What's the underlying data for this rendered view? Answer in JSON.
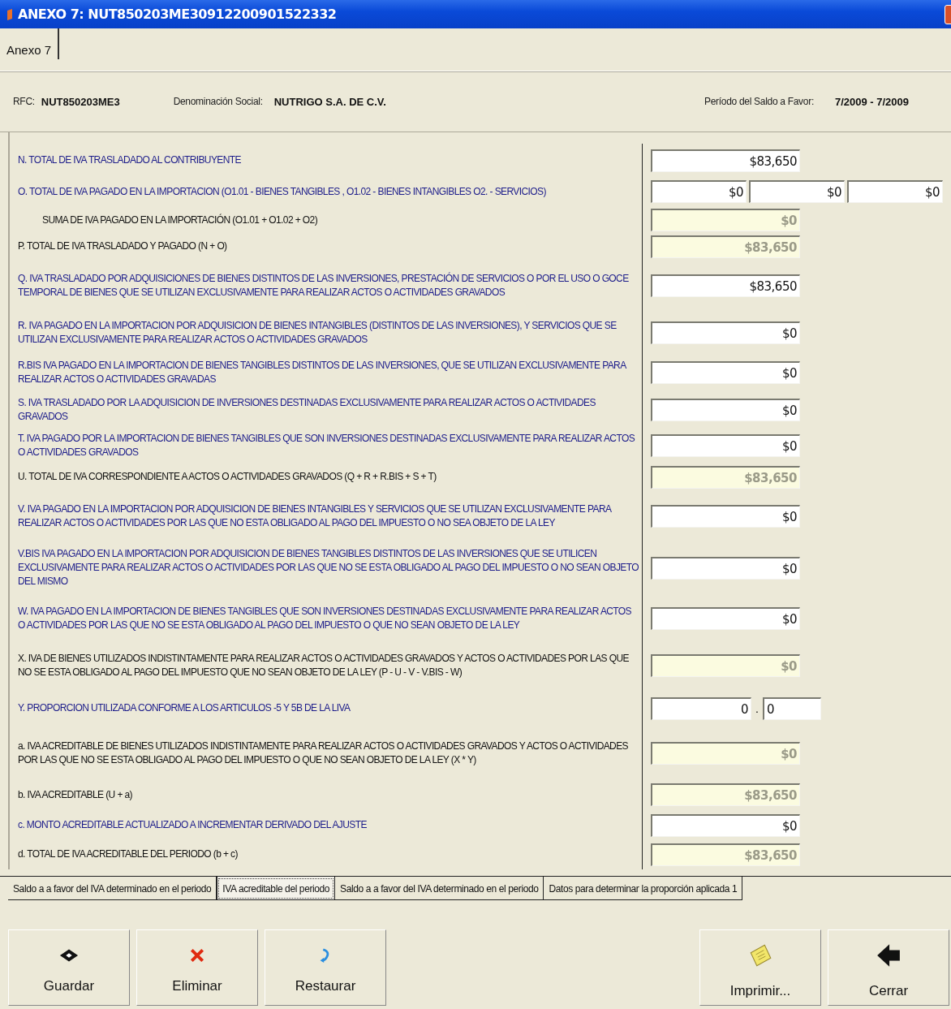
{
  "window": {
    "title": "ANEXO 7: NUT850203ME30912200901522332"
  },
  "top_tabs": [
    {
      "label": "Anexo 7"
    }
  ],
  "header": {
    "rfc_label": "RFC:",
    "rfc": "NUT850203ME3",
    "denominacion_label": "Denominación Social:",
    "denominacion": "NUTRIGO S.A. DE C.V.",
    "periodo_label": "Período del Saldo a Favor:",
    "periodo": "7/2009 - 7/2009"
  },
  "rows": [
    {
      "kind": "input",
      "label": "N. TOTAL DE IVA TRASLADADO AL CONTRIBUYENTE",
      "fields": [
        {
          "value": "$83,650",
          "disabled": false
        }
      ]
    },
    {
      "kind": "input",
      "label": "O.  TOTAL DE IVA PAGADO EN LA IMPORTACION (O1.01 - BIENES TANGIBLES , O1.02 - BIENES INTANGIBLES  O2. - SERVICIOS)",
      "fields": [
        {
          "value": "$0",
          "disabled": false
        },
        {
          "value": "$0",
          "disabled": false
        },
        {
          "value": "$0",
          "disabled": false
        }
      ]
    },
    {
      "kind": "sub",
      "label": "SUMA DE IVA PAGADO EN LA IMPORTACIÓN (O1.01 + O1.02 + O2)",
      "fields": [
        {
          "value": "$0",
          "disabled": true
        }
      ]
    },
    {
      "kind": "calculated",
      "label": "P. TOTAL DE IVA TRASLADADO Y PAGADO (N + O)",
      "fields": [
        {
          "value": "$83,650",
          "disabled": true
        }
      ]
    },
    {
      "kind": "input",
      "label": "Q. IVA TRASLADADO POR ADQUISICIONES DE BIENES DISTINTOS DE LAS INVERSIONES, PRESTACIÓN DE SERVICIOS O POR EL USO O GOCE TEMPORAL DE BIENES QUE SE UTILIZAN EXCLUSIVAMENTE PARA REALIZAR ACTOS O ACTIVIDADES GRAVADOS",
      "fields": [
        {
          "value": "$83,650",
          "disabled": false
        }
      ]
    },
    {
      "kind": "input",
      "label": "R. IVA PAGADO EN LA IMPORTACION POR ADQUISICION DE BIENES INTANGIBLES (DISTINTOS DE LAS INVERSIONES), Y SERVICIOS QUE SE UTILIZAN EXCLUSIVAMENTE PARA REALIZAR ACTOS O ACTIVIDADES GRAVADOS",
      "fields": [
        {
          "value": "$0",
          "disabled": false
        }
      ]
    },
    {
      "kind": "input",
      "label": "R.BIS  IVA PAGADO EN LA IMPORTACION DE BIENES TANGIBLES DISTINTOS DE LAS INVERSIONES, QUE SE UTILIZAN EXCLUSIVAMENTE PARA REALIZAR ACTOS O ACTIVIDADES GRAVADAS",
      "fields": [
        {
          "value": "$0",
          "disabled": false
        }
      ]
    },
    {
      "kind": "input",
      "label": "S. IVA TRASLADADO POR LA ADQUISICION DE INVERSIONES DESTINADAS EXCLUSIVAMENTE PARA REALIZAR ACTOS O ACTIVIDADES GRAVADOS",
      "fields": [
        {
          "value": "$0",
          "disabled": false
        }
      ]
    },
    {
      "kind": "input",
      "label": "T. IVA PAGADO POR LA IMPORTACION DE BIENES TANGIBLES QUE SON INVERSIONES DESTINADAS EXCLUSIVAMENTE PARA REALIZAR ACTOS O ACTIVIDADES GRAVADOS",
      "fields": [
        {
          "value": "$0",
          "disabled": false
        }
      ]
    },
    {
      "kind": "calculated",
      "label": "U. TOTAL DE IVA CORRESPONDIENTE A ACTOS O ACTIVIDADES GRAVADOS  (Q + R + R.BIS + S + T)",
      "fields": [
        {
          "value": "$83,650",
          "disabled": true
        }
      ]
    },
    {
      "kind": "input",
      "label": "V. IVA PAGADO EN LA IMPORTACION POR ADQUISICION DE BIENES INTANGIBLES Y SERVICIOS QUE SE UTILIZAN EXCLUSIVAMENTE PARA REALIZAR ACTOS O ACTIVIDADES POR LAS QUE NO ESTA OBLIGADO AL PAGO DEL IMPUESTO O NO SEA OBJETO DE LA LEY",
      "fields": [
        {
          "value": "$0",
          "disabled": false
        }
      ]
    },
    {
      "kind": "input",
      "label": "V.BIS  IVA PAGADO EN LA IMPORTACION POR ADQUISICION DE BIENES TANGIBLES DISTINTOS DE LAS INVERSIONES QUE SE UTILICEN EXCLUSIVAMENTE PARA REALIZAR ACTOS O ACTIVIDADES POR LAS QUE NO SE ESTA OBLIGADO AL PAGO DEL IMPUESTO O NO SEAN OBJETO DEL MISMO",
      "fields": [
        {
          "value": "$0",
          "disabled": false
        }
      ]
    },
    {
      "kind": "input",
      "label": "W. IVA PAGADO EN LA IMPORTACION DE BIENES TANGIBLES QUE SON INVERSIONES DESTINADAS EXCLUSIVAMENTE PARA REALIZAR ACTOS O ACTIVIDADES POR LAS QUE NO SE ESTA OBLIGADO AL PAGO DEL IMPUESTO O QUE NO SEAN OBJETO DE LA LEY",
      "fields": [
        {
          "value": "$0",
          "disabled": false
        }
      ]
    },
    {
      "kind": "calculated",
      "label": "X. IVA DE BIENES UTILIZADOS INDISTINTAMENTE PARA REALIZAR ACTOS O ACTIVIDADES GRAVADOS Y ACTOS O ACTIVIDADES POR LAS QUE NO SE ESTA OBLIGADO AL PAGO DEL IMPUESTO QUE NO SEAN OBJETO DE LA LEY (P - U - V - V.BIS - W)",
      "fields": [
        {
          "value": "$0",
          "disabled": true
        }
      ]
    },
    {
      "kind": "ratio",
      "label": "Y. PROPORCION UTILIZADA CONFORME A LOS ARTICULOS -5 Y 5B DE LA LIVA",
      "separator": ".",
      "fields": [
        {
          "value": "0",
          "disabled": false
        },
        {
          "value": "0",
          "disabled": false
        }
      ]
    },
    {
      "kind": "calculated",
      "label": "a. IVA ACREDITABLE DE BIENES UTILIZADOS INDISTINTAMENTE PARA REALIZAR ACTOS O ACTIVIDADES GRAVADOS Y ACTOS O ACTIVIDADES POR LAS QUE NO SE ESTA OBLIGADO AL PAGO DEL IMPUESTO O QUE NO SEAN OBJETO DE LA LEY (X * Y)",
      "fields": [
        {
          "value": "$0",
          "disabled": true
        }
      ]
    },
    {
      "kind": "calculated",
      "label": "b. IVA ACREDITABLE (U + a)",
      "fields": [
        {
          "value": "$83,650",
          "disabled": true
        }
      ]
    },
    {
      "kind": "input",
      "label": "c. MONTO ACREDITABLE ACTUALIZADO A INCREMENTAR DERIVADO DEL AJUSTE",
      "fields": [
        {
          "value": "$0",
          "disabled": false
        }
      ]
    },
    {
      "kind": "calculated",
      "label": "d. TOTAL DE IVA ACREDITABLE DEL PERIODO (b + c)",
      "fields": [
        {
          "value": "$83,650",
          "disabled": true
        }
      ]
    }
  ],
  "bottom_tabs": [
    {
      "label": "Saldo a a favor del IVA determinado en el periodo",
      "selected": false
    },
    {
      "label": "IVA acreditable del periodo",
      "selected": true
    },
    {
      "label": "Saldo a a favor del IVA determinado en el periodo",
      "selected": false
    },
    {
      "label": "Datos para determinar la proporción aplicada 1",
      "selected": false
    }
  ],
  "buttons": [
    {
      "label": "Guardar",
      "kind": "save"
    },
    {
      "label": "Eliminar",
      "kind": "delete"
    },
    {
      "label": "Restaurar",
      "kind": "restore"
    },
    {
      "label": "Imprimir...",
      "kind": "print"
    },
    {
      "label": "Cerrar",
      "kind": "close"
    }
  ]
}
